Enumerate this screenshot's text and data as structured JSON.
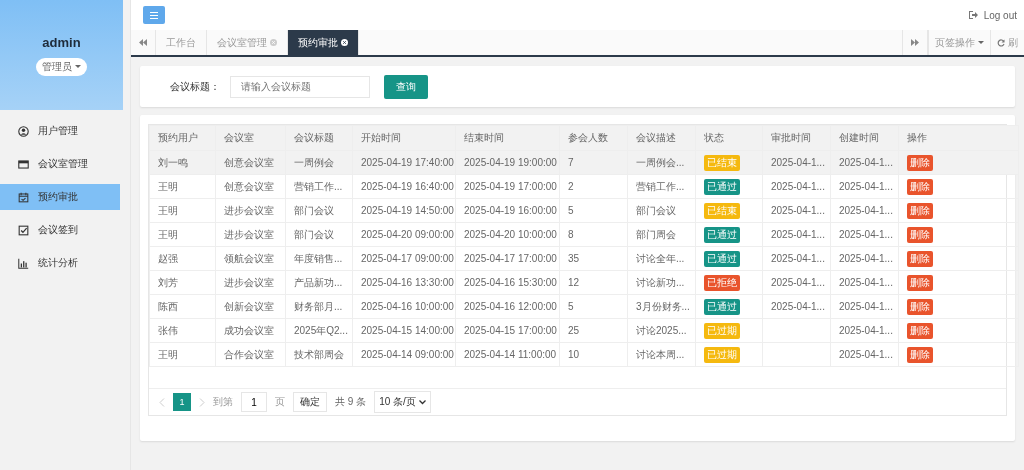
{
  "sidebar": {
    "user": "admin",
    "role": "管理员",
    "items": [
      {
        "label": "用户管理",
        "selected": false
      },
      {
        "label": "会议室管理",
        "selected": false
      },
      {
        "label": "预约审批",
        "selected": true
      },
      {
        "label": "会议签到",
        "selected": false
      },
      {
        "label": "统计分析",
        "selected": false
      }
    ]
  },
  "topbar": {
    "logout": "Log out"
  },
  "tabs": [
    {
      "label": "工作台",
      "selected": false,
      "closable": false
    },
    {
      "label": "会议室管理",
      "selected": false,
      "closable": true
    },
    {
      "label": "预约审批",
      "selected": true,
      "closable": true
    }
  ],
  "tab_tools": {
    "page_ops": "页签操作",
    "refresh": "刷"
  },
  "search": {
    "label": "会议标题：",
    "placeholder": "请输入会议标题",
    "button": "查询"
  },
  "table": {
    "columns": [
      "预约用户",
      "会议室",
      "会议标题",
      "开始时间",
      "结束时间",
      "参会人数",
      "会议描述",
      "状态",
      "审批时间",
      "创建时间",
      "操作"
    ],
    "rows": [
      {
        "selected": true,
        "user": "刘一鸣",
        "room": "创意会议室",
        "title": "一周例会",
        "start": "2025-04-19 17:40:00",
        "end": "2025-04-19 19:00:00",
        "count": "7",
        "desc": "一周例会...",
        "status": "已结束",
        "color": "#f5b90f",
        "approved": "2025-04-1...",
        "created": "2025-04-1...",
        "action": "删除"
      },
      {
        "selected": false,
        "user": "王明",
        "room": "创意会议室",
        "title": "营销工作...",
        "start": "2025-04-19 16:40:00",
        "end": "2025-04-19 17:00:00",
        "count": "2",
        "desc": "营销工作...",
        "status": "已通过",
        "color": "#169487",
        "approved": "2025-04-1...",
        "created": "2025-04-1...",
        "action": "删除"
      },
      {
        "selected": false,
        "user": "王明",
        "room": "进步会议室",
        "title": "部门会议",
        "start": "2025-04-19 14:50:00",
        "end": "2025-04-19 16:00:00",
        "count": "5",
        "desc": "部门会议",
        "status": "已结束",
        "color": "#f5b90f",
        "approved": "2025-04-1...",
        "created": "2025-04-1...",
        "action": "删除"
      },
      {
        "selected": false,
        "user": "王明",
        "room": "进步会议室",
        "title": "部门会议",
        "start": "2025-04-20 09:00:00",
        "end": "2025-04-20 10:00:00",
        "count": "8",
        "desc": "部门周会",
        "status": "已通过",
        "color": "#169487",
        "approved": "2025-04-1...",
        "created": "2025-04-1...",
        "action": "删除"
      },
      {
        "selected": false,
        "user": "赵强",
        "room": "领航会议室",
        "title": "年度销售...",
        "start": "2025-04-17 09:00:00",
        "end": "2025-04-17 17:00:00",
        "count": "35",
        "desc": "讨论全年...",
        "status": "已通过",
        "color": "#169487",
        "approved": "2025-04-1...",
        "created": "2025-04-1...",
        "action": "删除"
      },
      {
        "selected": false,
        "user": "刘芳",
        "room": "进步会议室",
        "title": "产品新功...",
        "start": "2025-04-16 13:30:00",
        "end": "2025-04-16 15:30:00",
        "count": "12",
        "desc": "讨论新功...",
        "status": "已拒绝",
        "color": "#e9542c",
        "approved": "2025-04-1...",
        "created": "2025-04-1...",
        "action": "删除"
      },
      {
        "selected": false,
        "user": "陈西",
        "room": "创新会议室",
        "title": "财务部月...",
        "start": "2025-04-16 10:00:00",
        "end": "2025-04-16 12:00:00",
        "count": "5",
        "desc": "3月份财务...",
        "status": "已通过",
        "color": "#169487",
        "approved": "2025-04-1...",
        "created": "2025-04-1...",
        "action": "删除"
      },
      {
        "selected": false,
        "user": "张伟",
        "room": "成功会议室",
        "title": "2025年Q2...",
        "start": "2025-04-15 14:00:00",
        "end": "2025-04-15 17:00:00",
        "count": "25",
        "desc": "讨论2025...",
        "status": "已过期",
        "color": "#f5b90f",
        "created": "2025-04-1...",
        "action": "删除"
      },
      {
        "selected": false,
        "user": "王明",
        "room": "合作会议室",
        "title": "技术部周会",
        "start": "2025-04-14 09:00:00",
        "end": "2025-04-14 11:00:00",
        "count": "10",
        "desc": "讨论本周...",
        "status": "已过期",
        "color": "#f5b90f",
        "created": "2025-04-1...",
        "action": "删除"
      }
    ]
  },
  "pagination": {
    "pages": [
      {
        "label": "1",
        "selected": true
      }
    ],
    "goto": "到第",
    "page_value": "1",
    "page_unit": "页",
    "confirm": "确定",
    "total": "共 9 条",
    "per_page": "10 条/页"
  }
}
